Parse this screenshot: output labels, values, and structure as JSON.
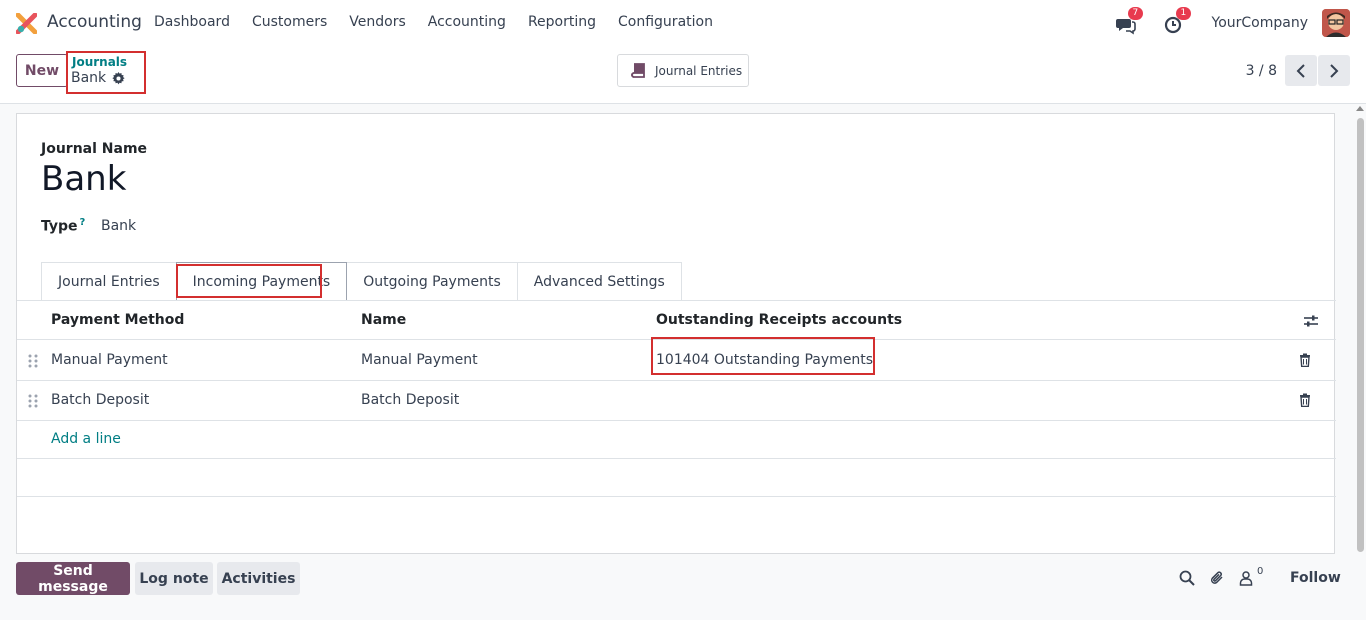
{
  "app": {
    "name": "Accounting",
    "menu": [
      "Dashboard",
      "Customers",
      "Vendors",
      "Accounting",
      "Reporting",
      "Configuration"
    ],
    "messages_badge": "7",
    "activities_badge": "1",
    "company": "YourCompany"
  },
  "control": {
    "new_label": "New",
    "breadcrumb_parent": "Journals",
    "breadcrumb_current": "Bank",
    "smart_button": "Journal Entries",
    "pager": "3 / 8"
  },
  "form": {
    "name_label": "Journal Name",
    "name_value": "Bank",
    "type_label": "Type",
    "type_help": "?",
    "type_value": "Bank",
    "tabs": [
      "Journal Entries",
      "Incoming Payments",
      "Outgoing Payments",
      "Advanced Settings"
    ],
    "active_tab": "Incoming Payments",
    "table": {
      "headers": [
        "Payment Method",
        "Name",
        "Outstanding Receipts accounts"
      ],
      "rows": [
        {
          "method": "Manual Payment",
          "name": "Manual Payment",
          "account": "101404 Outstanding Payments"
        },
        {
          "method": "Batch Deposit",
          "name": "Batch Deposit",
          "account": ""
        }
      ],
      "add_line": "Add a line"
    }
  },
  "chatter": {
    "send_message": "Send message",
    "log_note": "Log note",
    "activities": "Activities",
    "followers_count": "0",
    "follow": "Follow"
  },
  "colors": {
    "brand": "#714b67",
    "link": "#017e84",
    "highlight": "#d32f2f"
  }
}
